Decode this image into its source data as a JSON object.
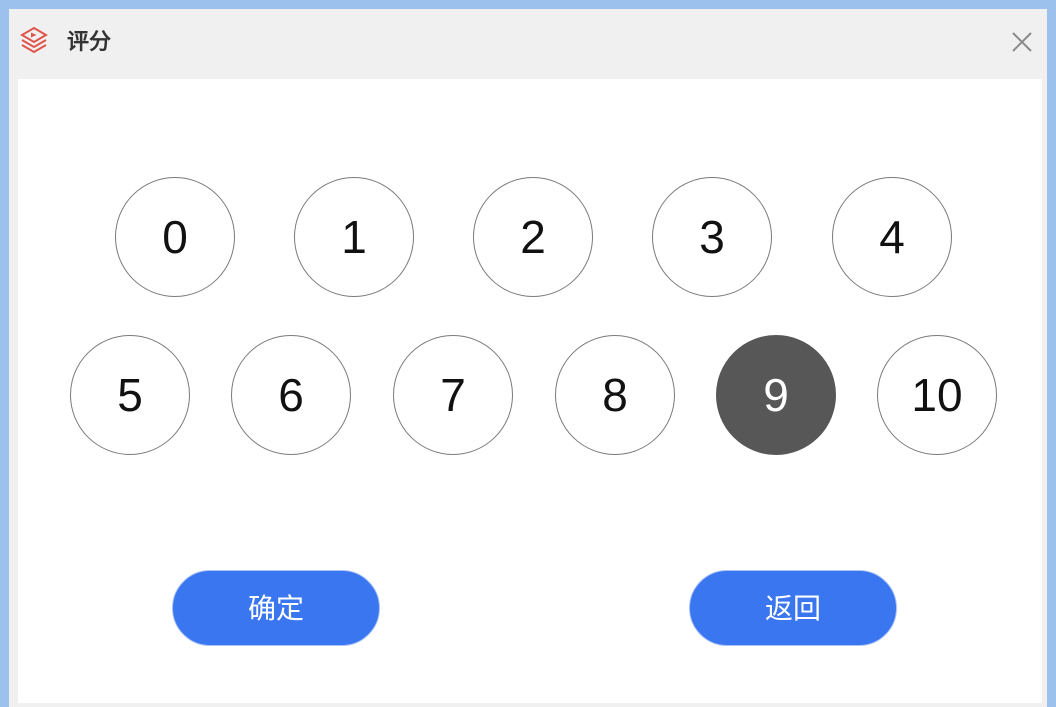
{
  "window": {
    "title": "评分",
    "app_icon": "layered-play-icon",
    "close_icon": "close-icon"
  },
  "scores": {
    "row1": [
      "0",
      "1",
      "2",
      "3",
      "4"
    ],
    "row2": [
      "5",
      "6",
      "7",
      "8",
      "9",
      "10"
    ],
    "selected": "9"
  },
  "actions": {
    "confirm_label": "确定",
    "back_label": "返回"
  },
  "colors": {
    "accent": "#3a76f0",
    "selected": "#575757",
    "brand_icon": "#e0554a"
  }
}
